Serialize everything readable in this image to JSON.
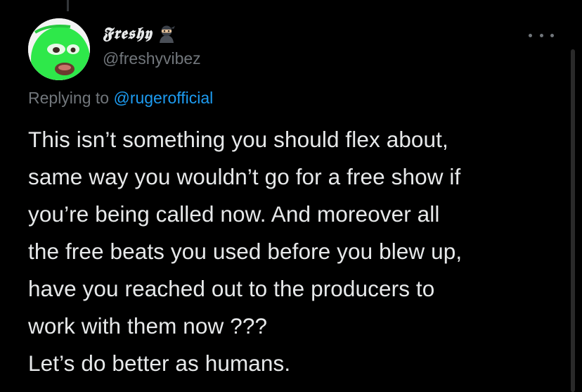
{
  "tweet": {
    "author": {
      "display_name": "𝕱𝖗𝖊𝖘𝖍𝖞",
      "emoji": "ninja",
      "handle": "@freshyvibez",
      "avatar_icon": "green-ski-mask-avatar"
    },
    "reply_context": {
      "prefix": "Replying to",
      "mention": "@rugerofficial"
    },
    "body_lines": [
      "This isn’t something you should flex about,",
      "same way you wouldn’t go for a free show if",
      "you’re being called now. And moreover all",
      "the free beats you used before you blew up,",
      "have you reached out to the producers to",
      "work with them now ???",
      "Let’s do better as humans."
    ],
    "more_icon": "more-options-icon"
  },
  "colors": {
    "background": "#000000",
    "text_primary": "#e7e9ea",
    "text_secondary": "#71767b",
    "accent": "#1d9bf0",
    "avatar_mask": "#2ee84a"
  }
}
